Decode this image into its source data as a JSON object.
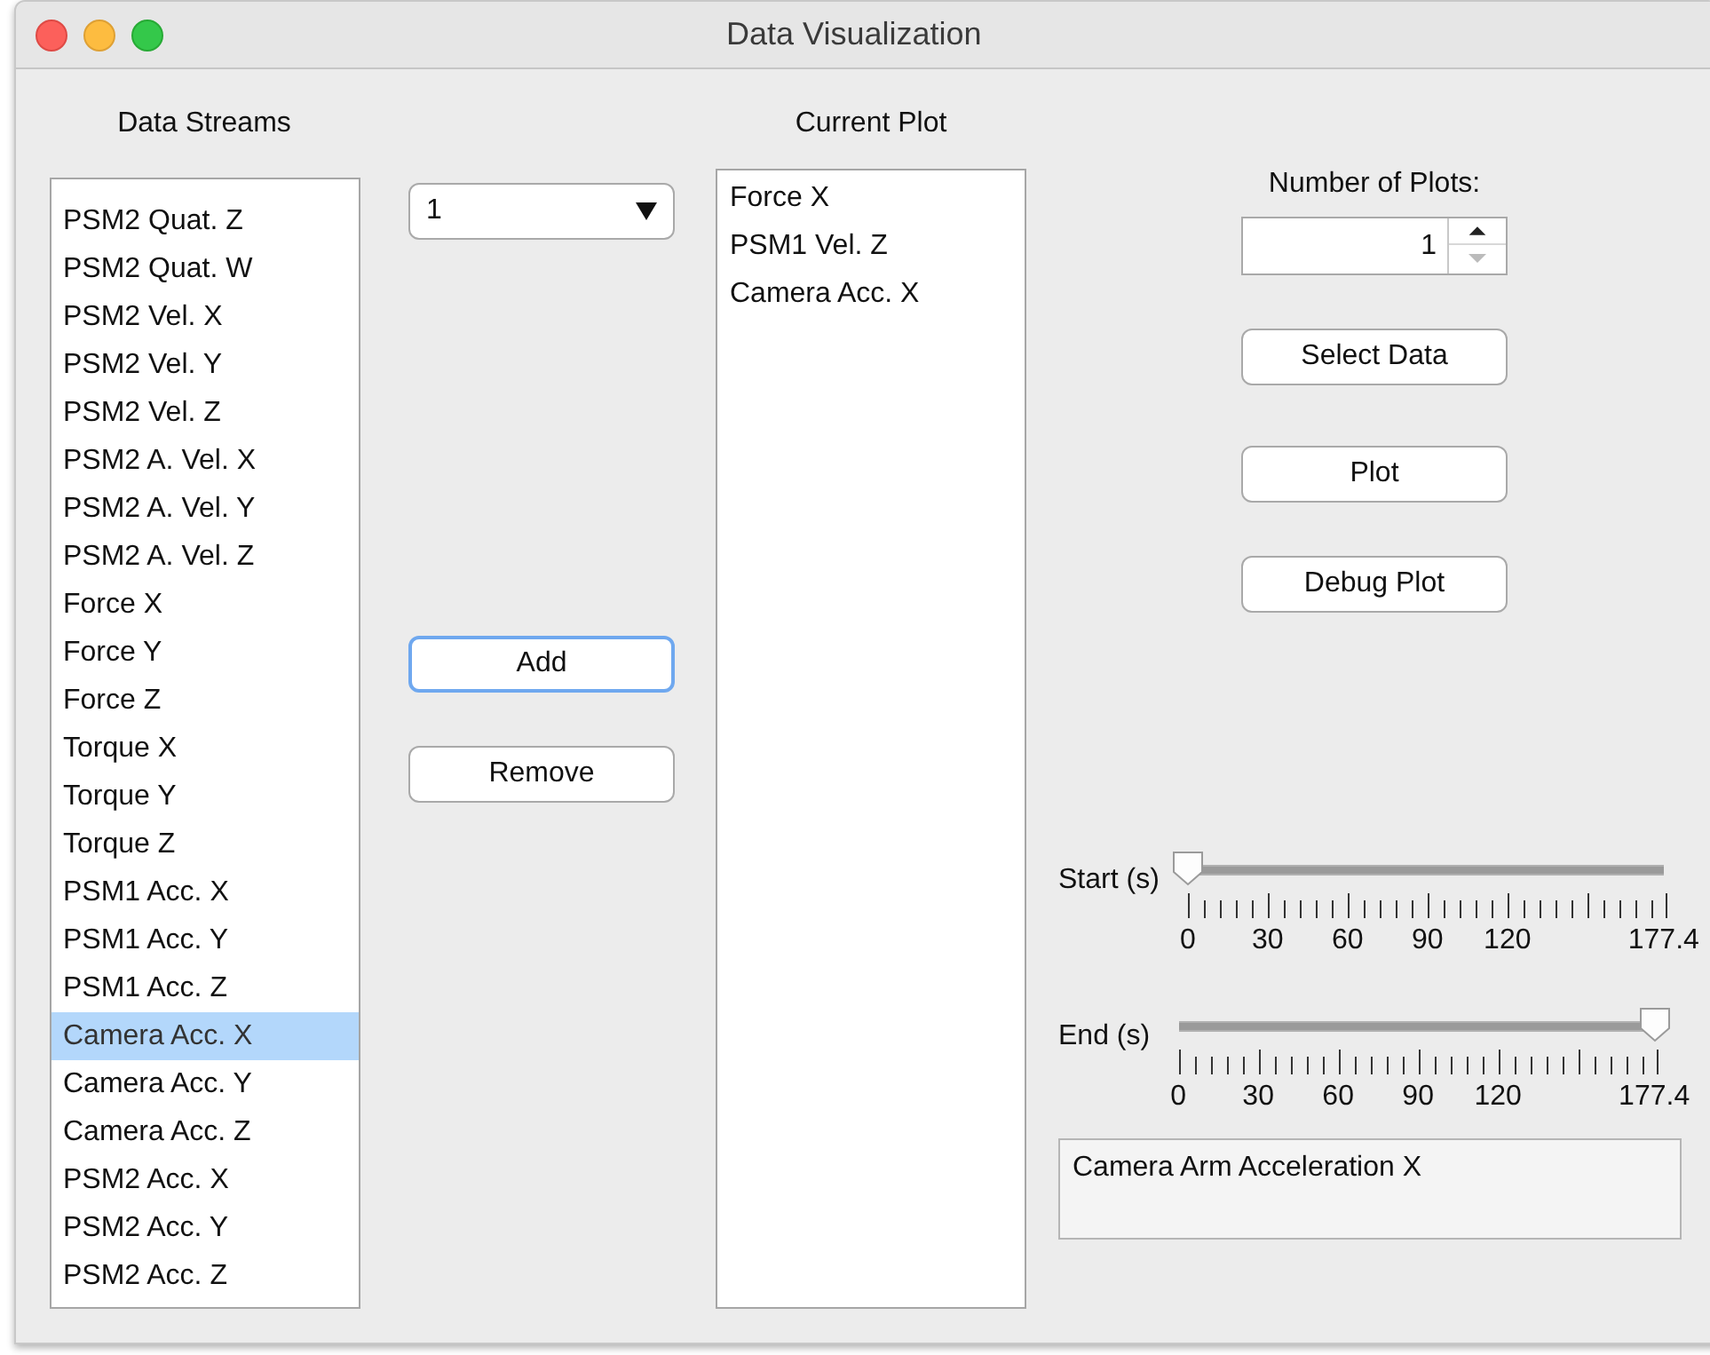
{
  "window": {
    "title": "Data Visualization"
  },
  "data_streams": {
    "label": "Data Streams",
    "items": [
      {
        "text": "PSM2 Quat. Z",
        "selected": false
      },
      {
        "text": "PSM2 Quat. W",
        "selected": false
      },
      {
        "text": "PSM2 Vel. X",
        "selected": false
      },
      {
        "text": "PSM2 Vel. Y",
        "selected": false
      },
      {
        "text": "PSM2 Vel. Z",
        "selected": false
      },
      {
        "text": "PSM2 A. Vel. X",
        "selected": false
      },
      {
        "text": "PSM2 A. Vel. Y",
        "selected": false
      },
      {
        "text": "PSM2 A. Vel. Z",
        "selected": false
      },
      {
        "text": "Force X",
        "selected": false
      },
      {
        "text": "Force Y",
        "selected": false
      },
      {
        "text": "Force Z",
        "selected": false
      },
      {
        "text": "Torque X",
        "selected": false
      },
      {
        "text": "Torque Y",
        "selected": false
      },
      {
        "text": "Torque Z",
        "selected": false
      },
      {
        "text": "PSM1 Acc. X",
        "selected": false
      },
      {
        "text": "PSM1 Acc. Y",
        "selected": false
      },
      {
        "text": "PSM1 Acc. Z",
        "selected": false
      },
      {
        "text": "Camera Acc. X",
        "selected": true
      },
      {
        "text": "Camera Acc. Y",
        "selected": false
      },
      {
        "text": "Camera Acc. Z",
        "selected": false
      },
      {
        "text": "PSM2 Acc. X",
        "selected": false
      },
      {
        "text": "PSM2 Acc. Y",
        "selected": false
      },
      {
        "text": "PSM2 Acc. Z",
        "selected": false
      }
    ]
  },
  "plot_dropdown": {
    "value": "1"
  },
  "add_button": {
    "label": "Add",
    "focused": true
  },
  "remove_button": {
    "label": "Remove",
    "focused": false
  },
  "current_plot": {
    "label": "Current Plot",
    "items": [
      "Force X",
      "PSM1 Vel. Z",
      "Camera Acc. X"
    ]
  },
  "number_of_plots": {
    "label": "Number of Plots:",
    "value": "1"
  },
  "buttons": [
    "Select Data",
    "Plot",
    "Debug Plot"
  ],
  "sliders": [
    {
      "label": "Start (s)",
      "level": 0,
      "tick_labels": [
        "0",
        "30",
        "60",
        "90",
        "120",
        "177.4"
      ]
    },
    {
      "label": "End (s)",
      "level": 1,
      "tick_labels": [
        "0",
        "30",
        "60",
        "90",
        "120",
        "177.4"
      ]
    }
  ],
  "description": {
    "text": "Camera Arm Acceleration X"
  }
}
